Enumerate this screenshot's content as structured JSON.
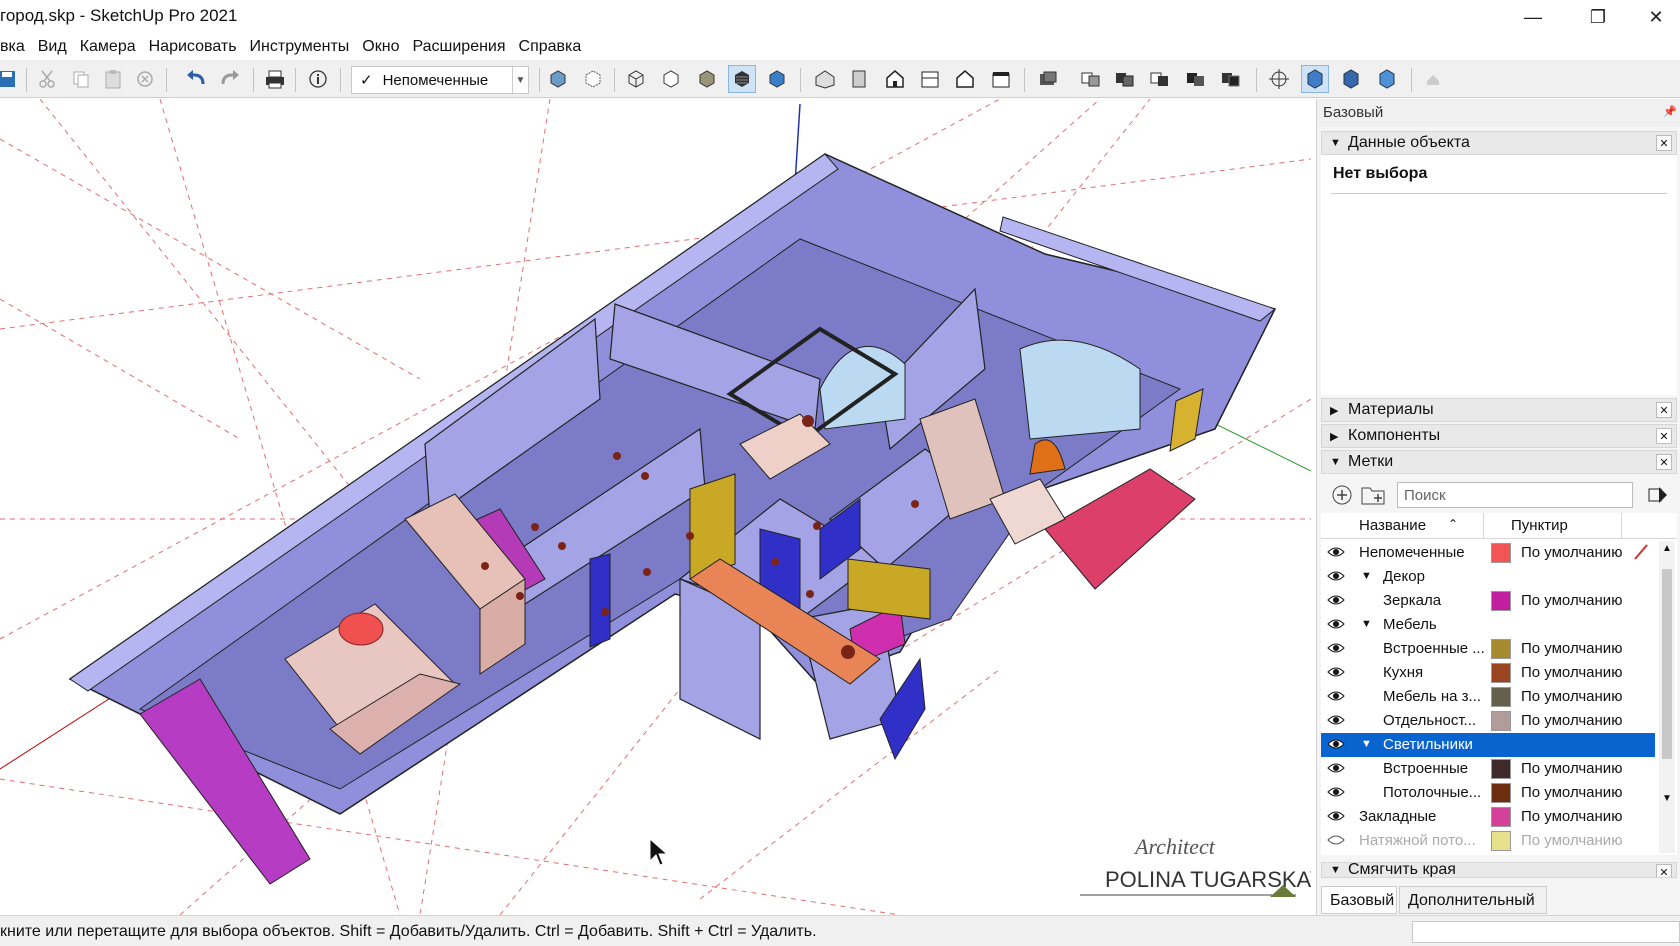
{
  "window": {
    "title": "город.skp - SketchUp Pro 2021",
    "minimize": "—",
    "restore": "❐",
    "close": "✕"
  },
  "menu": [
    "вка",
    "Вид",
    "Камера",
    "Нарисовать",
    "Инструменты",
    "Окно",
    "Расширения",
    "Справка"
  ],
  "toolbar": {
    "tag_dropdown_check": "✓",
    "tag_dropdown_value": "Непомеченные"
  },
  "tray": {
    "title": "Базовый",
    "entity_info": {
      "header": "Данные объекта",
      "no_selection": "Нет выбора"
    },
    "materials": "Материалы",
    "components": "Компоненты",
    "tags": {
      "header": "Метки",
      "search_placeholder": "Поиск",
      "col_name": "Название",
      "col_dash": "Пунктир",
      "rows": [
        {
          "name": "Непомеченные",
          "color": "#f25555",
          "dash": "По умолчанию"
        },
        {
          "name": "Декор",
          "expanded": true,
          "group": true
        },
        {
          "name": "Зеркала",
          "color": "#c21fa0",
          "dash": "По умолчанию"
        },
        {
          "name": "Мебель",
          "expanded": true,
          "group": true
        },
        {
          "name": "Встроенные ...",
          "color": "#a88a2e",
          "dash": "По умолчанию"
        },
        {
          "name": "Кухня",
          "color": "#9a4422",
          "dash": "По умолчанию"
        },
        {
          "name": "Мебель на з...",
          "color": "#63614c",
          "dash": "По умолчанию"
        },
        {
          "name": "Отдельност...",
          "color": "#b29c9a",
          "dash": "По умолчанию"
        },
        {
          "name": "Светильники",
          "expanded": true,
          "group": true,
          "selected": true
        },
        {
          "name": "Встроенные",
          "color": "#3e2a2a",
          "dash": "По умолчанию"
        },
        {
          "name": "Потолочные...",
          "color": "#6e2e10",
          "dash": "По умолчанию"
        },
        {
          "name": "Закладные",
          "color": "#d4419a",
          "dash": "По умолчанию"
        },
        {
          "name": "Натяжной пото...",
          "color": "#e6e08a",
          "dash": "По умолчанию",
          "hidden": true
        }
      ]
    },
    "soften": "Смягчить края",
    "tabs": [
      "Базовый",
      "Дополнительный"
    ]
  },
  "watermark": {
    "line1": "Architect",
    "line2": "POLINA TUGARSKAYA"
  },
  "status_text": "кните или перетащите для выбора объектов. Shift = Добавить/Удалить. Ctrl = Добавить. Shift + Ctrl = Удалить."
}
